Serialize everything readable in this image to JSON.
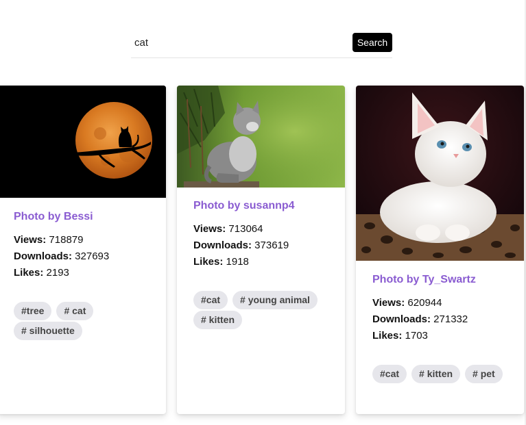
{
  "search": {
    "value": "cat",
    "button_label": "Search"
  },
  "cards": [
    {
      "author": "Photo by Bessi",
      "views_label": "Views:",
      "views": "718879",
      "downloads_label": "Downloads:",
      "downloads": "327693",
      "likes_label": "Likes:",
      "likes": "2193",
      "tags": [
        "#tree",
        "# cat",
        "# silhouette"
      ]
    },
    {
      "author": "Photo by susannp4",
      "views_label": "Views:",
      "views": "713064",
      "downloads_label": "Downloads:",
      "downloads": "373619",
      "likes_label": "Likes:",
      "likes": "1918",
      "tags": [
        "#cat",
        "# young animal",
        "# kitten"
      ]
    },
    {
      "author": "Photo by Ty_Swartz",
      "views_label": "Views:",
      "views": "620944",
      "downloads_label": "Downloads:",
      "downloads": "271332",
      "likes_label": "Likes:",
      "likes": "1703",
      "tags": [
        "#cat",
        "# kitten",
        "# pet"
      ]
    }
  ],
  "colors": {
    "author_text": "#8a5cd1",
    "tag_bg": "#e6e6eb",
    "button_bg": "#000000"
  }
}
